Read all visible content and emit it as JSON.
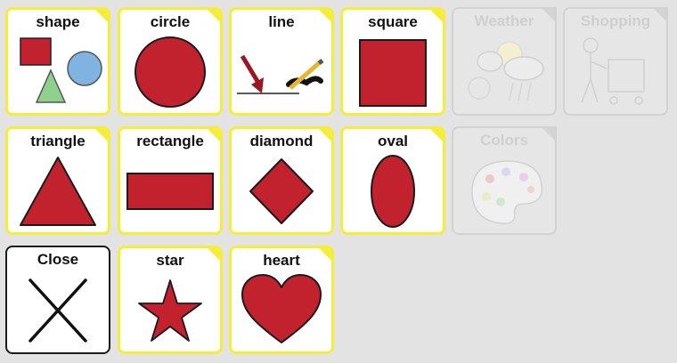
{
  "tiles": {
    "shape": "shape",
    "circle": "circle",
    "line": "line",
    "square": "square",
    "weather": "Weather",
    "shopping": "Shopping",
    "triangle": "triangle",
    "rectangle": "rectangle",
    "diamond": "diamond",
    "oval": "oval",
    "colors": "Colors",
    "close": "Close",
    "star": "star",
    "heart": "heart"
  },
  "colors": {
    "tile_border": "#f4ee3a",
    "symbol_red": "#c1222d",
    "background": "#e3e3e3",
    "folder_text": "#cfcfcf"
  }
}
